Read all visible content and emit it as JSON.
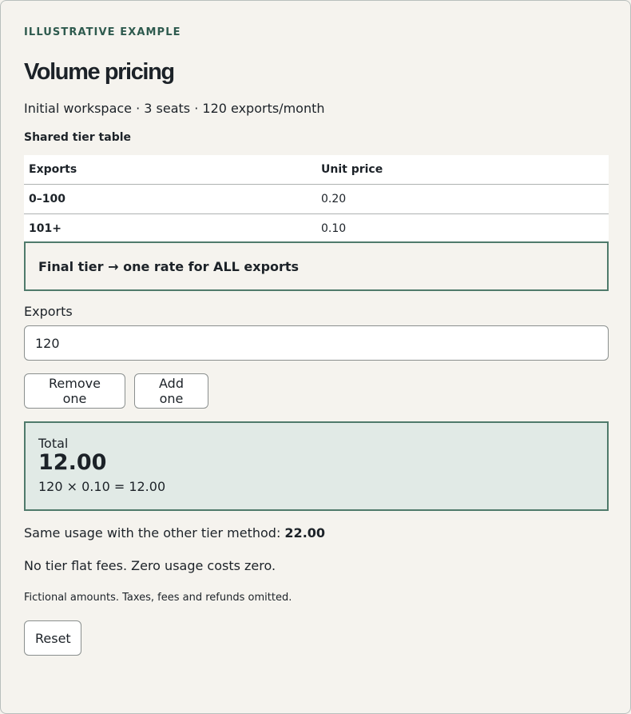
{
  "eyebrow": "ILLUSTRATIVE EXAMPLE",
  "title": "Volume pricing",
  "subtitle": "Initial workspace · 3 seats · 120 exports/month",
  "tier_table": {
    "caption": "Shared tier table",
    "headers": [
      "Exports",
      "Unit price"
    ],
    "rows": [
      {
        "exports": "0–100",
        "unit_price": "0.20"
      },
      {
        "exports": "101+",
        "unit_price": "0.10"
      }
    ]
  },
  "notice": "Final tier → one rate for ALL exports",
  "exports_field": {
    "label": "Exports",
    "value": "120"
  },
  "buttons": {
    "remove": "Remove one",
    "add": "Add one",
    "reset": "Reset"
  },
  "total": {
    "label": "Total",
    "value": "12.00",
    "formula": "120 × 0.10 = 12.00"
  },
  "comparison": {
    "text": "Same usage with the other tier method: ",
    "value": "22.00"
  },
  "note": "No tier flat fees. Zero usage costs zero.",
  "fineprint": "Fictional amounts. Taxes, fees and refunds omitted.",
  "colors": {
    "accent": "#2e5a4e",
    "border_accent": "#4f7a6b",
    "total_bg": "#e1eae6",
    "page_bg": "#f5f3ee"
  }
}
